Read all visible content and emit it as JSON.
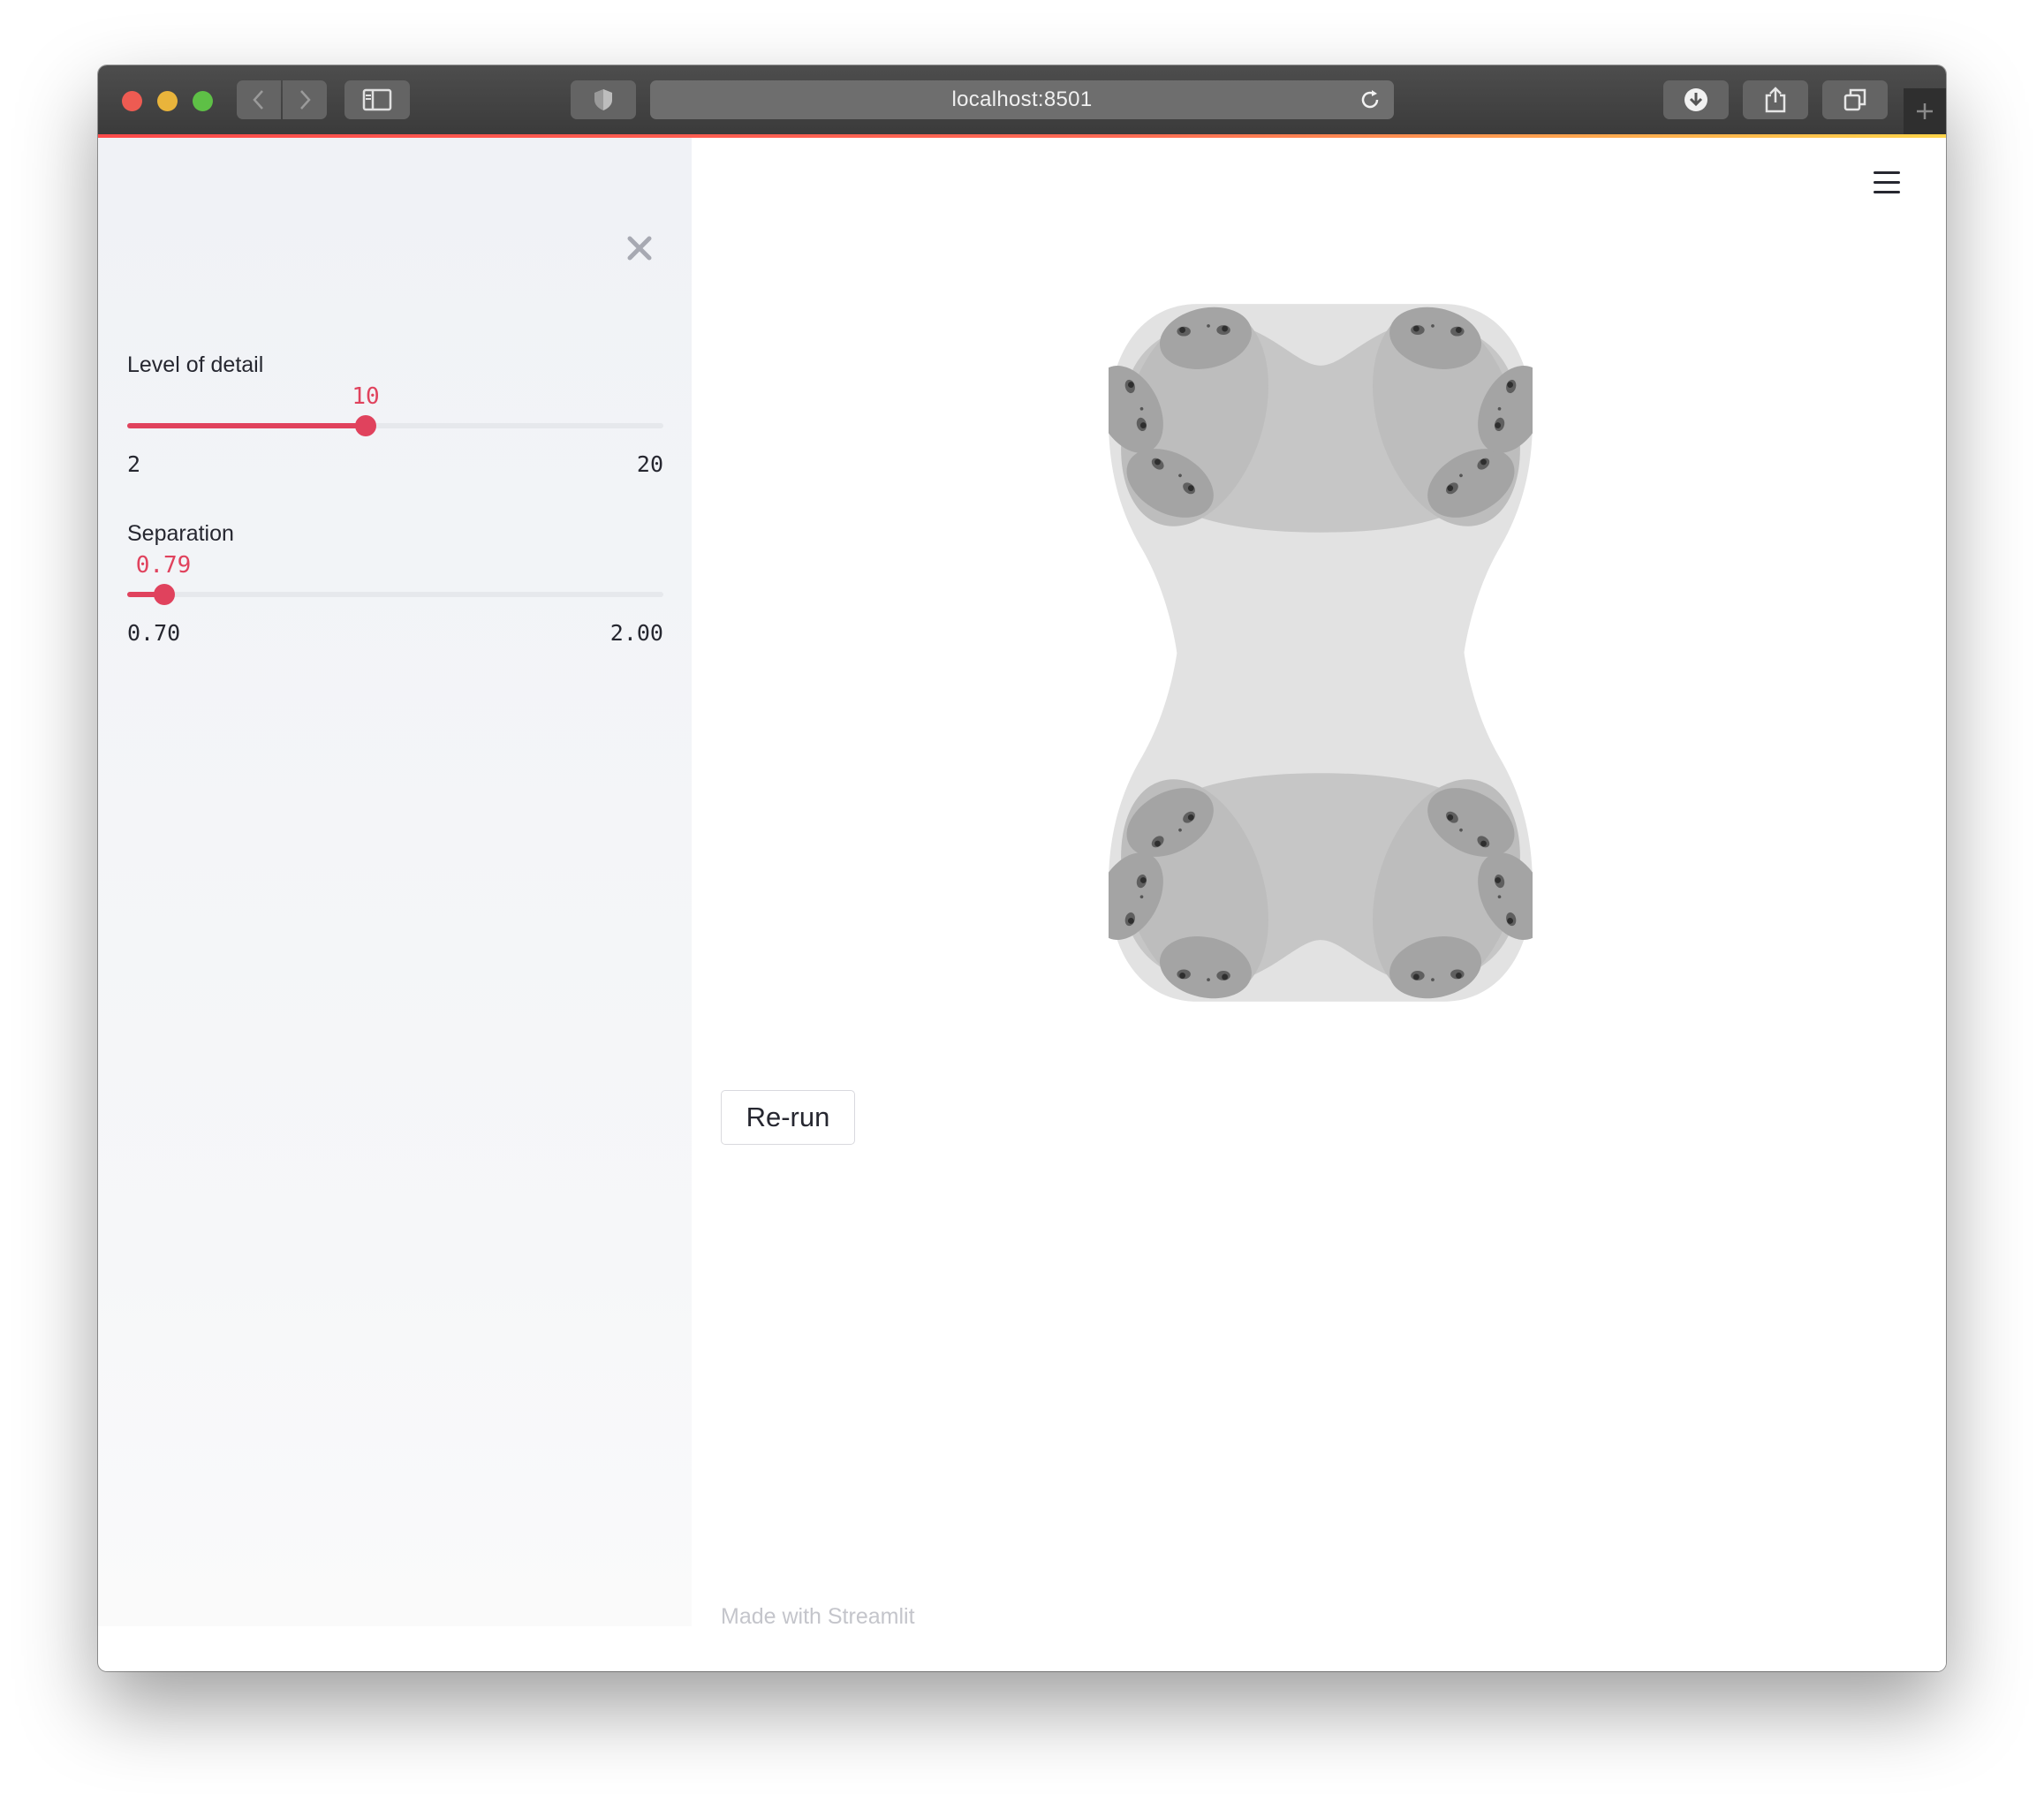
{
  "browser": {
    "url": "localhost:8501",
    "icons": [
      "back-icon",
      "forward-icon",
      "sidebar-toggle-icon",
      "shield-icon",
      "reload-icon",
      "download-icon",
      "share-icon",
      "tabs-icon",
      "new-tab-icon"
    ]
  },
  "sidebar": {
    "close_icon": "close-icon",
    "level_slider": {
      "label": "Level of detail",
      "value": "10",
      "min": "2",
      "max": "20",
      "fraction": 0.4444
    },
    "separation_slider": {
      "label": "Separation",
      "value": "0.79",
      "min": "0.70",
      "max": "2.00",
      "fraction": 0.0692
    }
  },
  "main": {
    "menu_icon": "hamburger-menu-icon",
    "rerun_label": "Re-run",
    "footer": "Made with Streamlit"
  },
  "colors": {
    "accent": "#e0425d",
    "sidebar_bg": "#f0f2f6",
    "fractal_shades": [
      "#e2e2e2",
      "#c6c6c6",
      "#a4a4a4",
      "#7b7b7b",
      "#3a3a3a"
    ]
  }
}
